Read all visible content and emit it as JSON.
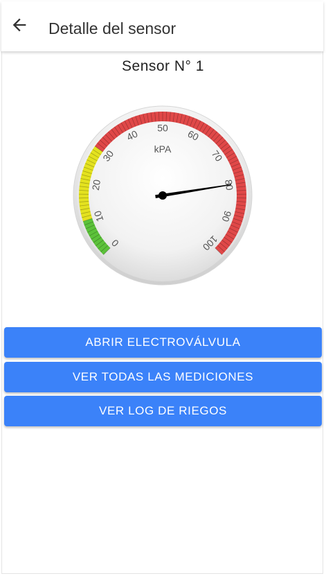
{
  "appbar": {
    "title": "Detalle del sensor",
    "back_icon": "arrow-left-icon"
  },
  "sensor": {
    "title": "Sensor N° 1"
  },
  "gauge": {
    "unit": "kPA",
    "min": 0,
    "max": 100,
    "value": 80,
    "tick_labels": [
      "0",
      "10",
      "20",
      "30",
      "40",
      "50",
      "60",
      "70",
      "80",
      "90",
      "100"
    ],
    "bands": [
      {
        "from": 0,
        "to": 10,
        "color": "#5cc23a"
      },
      {
        "from": 10,
        "to": 30,
        "color": "#e4e21f"
      },
      {
        "from": 30,
        "to": 100,
        "color": "#e04848"
      }
    ]
  },
  "actions": {
    "open_valve": "ABRIR ELECTROVÁLVULA",
    "all_measurements": "VER TODAS LAS MEDICIONES",
    "irrigation_log": "VER LOG DE RIEGOS"
  },
  "colors": {
    "accent": "#3b82f9",
    "needle": "#000000"
  }
}
